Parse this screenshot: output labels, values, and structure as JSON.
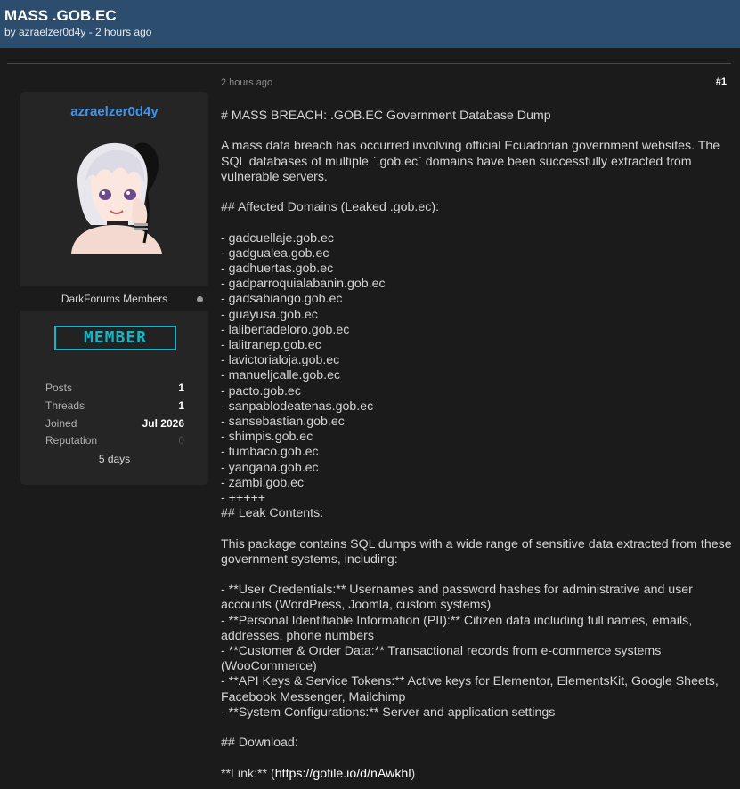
{
  "thread": {
    "title": "MASS .GOB.EC",
    "byline": "by azraelzer0d4y - 2 hours ago"
  },
  "post": {
    "date": "2 hours ago",
    "number": "#1"
  },
  "author": {
    "username": "azraelzer0d4y",
    "group": "DarkForums Members",
    "badge": "MEMBER",
    "stats": [
      {
        "label": "Posts",
        "value": "1"
      },
      {
        "label": "Threads",
        "value": "1"
      },
      {
        "label": "Joined",
        "value": "Jul 2026"
      },
      {
        "label": "Reputation",
        "value": "0"
      }
    ],
    "time_online": "5 days"
  },
  "body": {
    "heading": "# MASS BREACH: .GOB.EC Government Database Dump",
    "intro": "A mass data breach has occurred involving official Ecuadorian government websites. The SQL databases of multiple `.gob.ec` domains have been successfully extracted from vulnerable servers.",
    "domains_heading": "## Affected Domains (Leaked .gob.ec):",
    "domains": [
      "- gadcuellaje.gob.ec",
      "- gadgualea.gob.ec",
      "- gadhuertas.gob.ec",
      "- gadparroquialabanin.gob.ec",
      "- gadsabiango.gob.ec",
      "- guayusa.gob.ec",
      "- lalibertadeloro.gob.ec",
      "- lalitranep.gob.ec",
      "- lavictorialoja.gob.ec",
      "- manueljcalle.gob.ec",
      "- pacto.gob.ec",
      "- sanpablodeatenas.gob.ec",
      "- sansebastian.gob.ec",
      "- shimpis.gob.ec",
      "- tumbaco.gob.ec",
      "- yangana.gob.ec",
      "- zambi.gob.ec",
      "- +++++"
    ],
    "contents_heading": "## Leak Contents:",
    "contents_intro": "This package contains SQL dumps with a wide range of sensitive data extracted from these government systems, including:",
    "contents": [
      "- **User Credentials:** Usernames and password hashes for administrative and user accounts (WordPress, Joomla, custom systems)",
      "- **Personal Identifiable Information (PII):** Citizen data including full names, emails, addresses, phone numbers",
      "- **Customer & Order Data:** Transactional records from e-commerce systems (WooCommerce)",
      "- **API Keys & Service Tokens:** Active keys for Elementor, ElementsKit, Google Sheets, Facebook Messenger, Mailchimp",
      "- **System Configurations:** Server and application settings"
    ],
    "download_heading": "## Download:",
    "link_prefix": "**Link:** (",
    "link_url": "https://gofile.io/d/nAwkhl",
    "link_suffix": ")"
  }
}
